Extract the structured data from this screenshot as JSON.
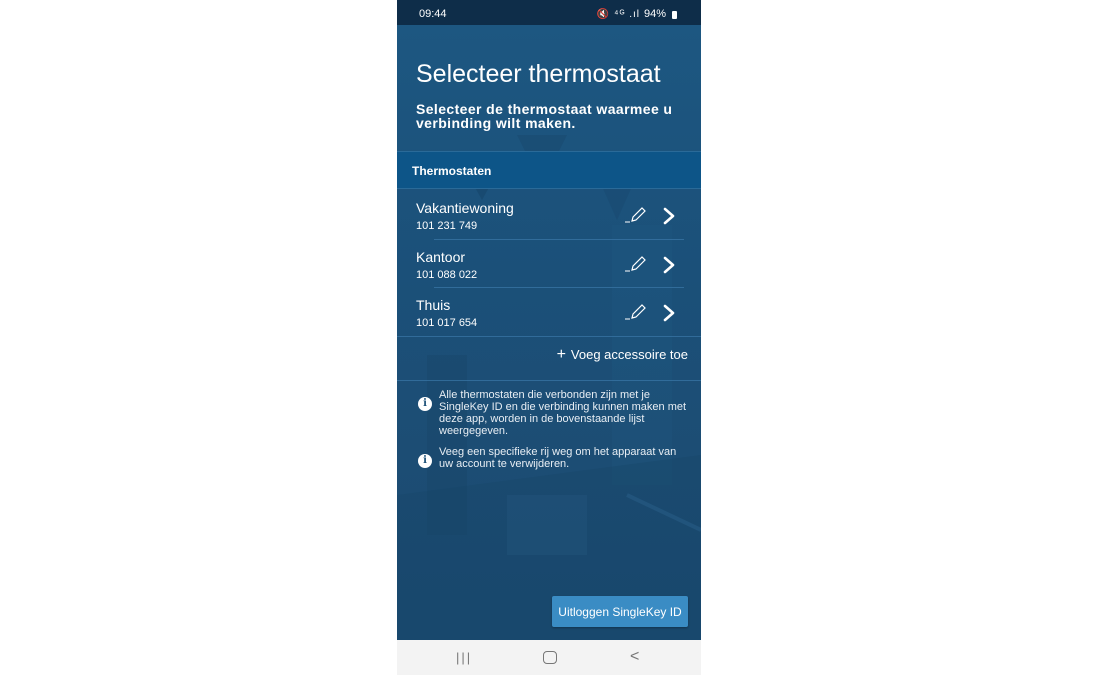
{
  "status_bar": {
    "time": "09:44",
    "battery": "94%",
    "icons": "🔇 ⁴ᴳ .ıl"
  },
  "page": {
    "title": "Selecteer thermostaat",
    "subtitle": "Selecteer de thermostaat waarmee u verbinding wilt maken."
  },
  "section": {
    "header": "Thermostaten"
  },
  "thermostats": [
    {
      "name": "Vakantiewoning",
      "id": "101 231 749"
    },
    {
      "name": "Kantoor",
      "id": "101 088 022"
    },
    {
      "name": "Thuis",
      "id": "101 017 654"
    }
  ],
  "add_accessory": {
    "label": "Voeg accessoire toe"
  },
  "info": [
    "Alle thermostaten die verbonden zijn met je SingleKey ID en die verbinding kunnen maken met deze app, worden in de bovenstaande lijst weergegeven.",
    "Veeg een specifieke rij weg om het apparaat van uw account te verwijderen."
  ],
  "logout_button": {
    "label": "Uitloggen SingleKey ID"
  },
  "nav": {
    "recents": "|||",
    "back": "<"
  },
  "colors": {
    "background": "#1b4f77",
    "header": "#0d5588",
    "button": "#3a8cc4",
    "statusbar": "#0e2d49"
  }
}
